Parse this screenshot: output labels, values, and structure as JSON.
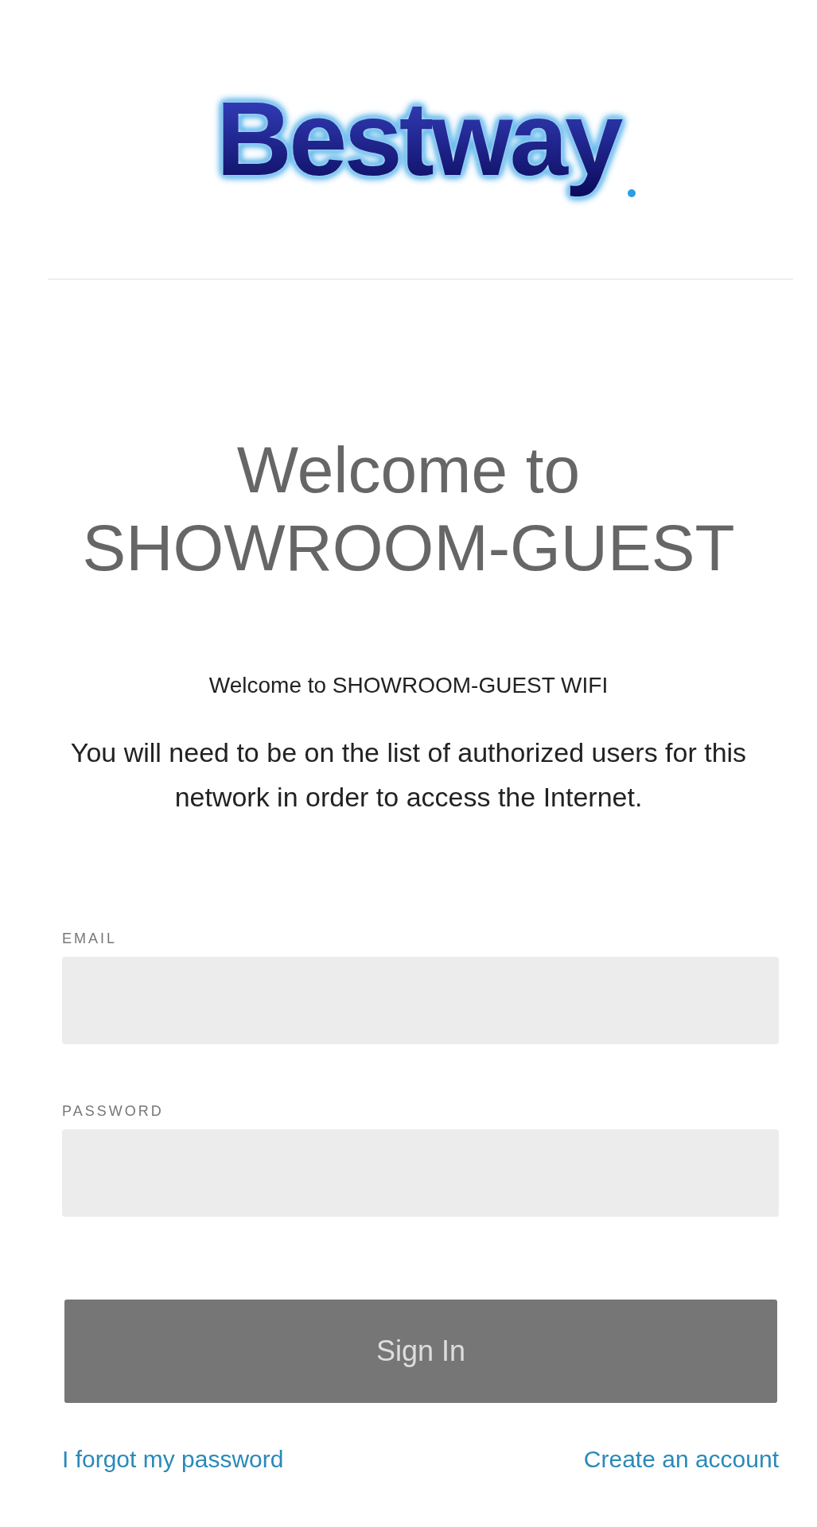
{
  "logo": {
    "text": "Bestway"
  },
  "heading": [
    "Welcome to",
    "SHOWROOM-GUEST"
  ],
  "subtitle": "Welcome to SHOWROOM-GUEST WIFI",
  "message": "You will need to be on the list of authorized users for this network in order to access the Internet.",
  "fields": [
    {
      "label": "EMAIL"
    },
    {
      "label": "PASSWORD"
    }
  ],
  "sign_in_button": {
    "label": "Sign In",
    "disabled": true
  },
  "links": [
    "I forgot my password",
    "Create an account"
  ]
}
